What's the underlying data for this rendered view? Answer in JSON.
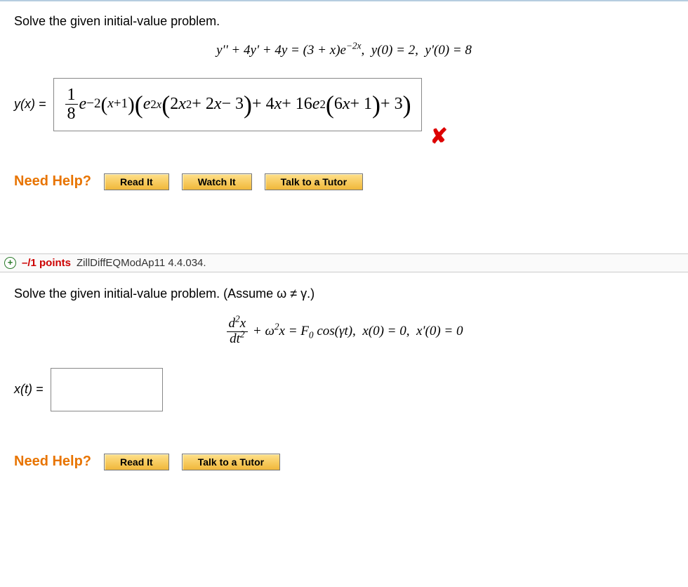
{
  "q1": {
    "prompt": "Solve the given initial-value problem.",
    "equation_html": "<span class='mi'>y</span>'' + 4<span class='mi'>y</span>' + 4<span class='mi'>y</span> = (3 + <span class='mi'>x</span>)<span class='mi'>e</span><sup>−2<span class='mi'>x</span></sup>, &nbsp;<span class='mi'>y</span>(0) = 2, &nbsp;<span class='mi'>y</span>'(0) = 8",
    "answer_label": "y(x) = ",
    "answer_html": "<span class='frac'><span class='num'>1</span><span class='den'>8</span></span><span class='mi'>e</span><sup style='font-size:0.8em'>−2<span class='bigparen'>(</span><span class='mi'>x</span>+1<span class='bigparen'>)</span></sup><span class='bigparen'>(</span><span class='mi'>e</span><sup>2<span class='mi'>x</span></sup><span class='bigparen'>(</span>2<span class='mi'>x</span><sup>2</sup> + 2<span class='mi'>x</span> − 3<span class='bigparen'>)</span> + 4<span class='mi'>x</span> + 16<span class='mi'>e</span><sup>2</sup><span class='bigparen'>(</span>6<span class='mi'>x</span> + 1<span class='bigparen'>)</span> + 3<span class='bigparen'>)</span>",
    "feedback": "✘",
    "need_help_label": "Need Help?",
    "buttons": {
      "read": "Read It",
      "watch": "Watch It",
      "tutor": "Talk to a Tutor"
    }
  },
  "q2": {
    "points": "–/1 points",
    "source": "ZillDiffEQModAp11 4.4.034.",
    "prompt": "Solve the given initial-value problem. (Assume ω ≠ γ.)",
    "equation_html": "<span class='frac'><span class='num'><span class='mi'>d</span><sup>2</sup><span class='mi'>x</span></span><span class='den'><span class='mi'>dt</span><sup>2</sup></span></span> + <span class='mi'>ω</span><sup>2</sup><span class='mi'>x</span> = <span class='mi'>F</span><sub>0</sub> cos(<span class='mi'>γt</span>), &nbsp;<span class='mi'>x</span>(0) = 0, &nbsp;<span class='mi'>x</span>'(0) = 0",
    "answer_label": "x(t) = ",
    "need_help_label": "Need Help?",
    "buttons": {
      "read": "Read It",
      "tutor": "Talk to a Tutor"
    }
  }
}
